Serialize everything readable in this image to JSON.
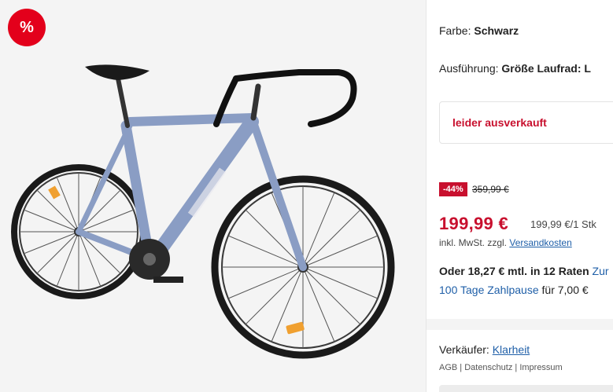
{
  "badge": {
    "symbol": "%"
  },
  "variant": {
    "color_label": "Farbe:",
    "color_value": "Schwarz",
    "model_label": "Ausführung:",
    "model_value": "Größe Laufrad: L"
  },
  "availability": {
    "status": "leider ausverkauft"
  },
  "pricing": {
    "discount": "-44%",
    "old_price": "359,99 €",
    "price": "199,99 €",
    "unit_price": "199,99 €/1 Stk",
    "tax_note": "inkl. MwSt. zzgl.",
    "shipping_link": "Versandkosten"
  },
  "financing": {
    "text": "Oder 18,27 € mtl. in 12 Raten",
    "more_link": "Zur",
    "pause_link": "100 Tage Zahlpause",
    "pause_suffix": "für 7,00 €"
  },
  "seller": {
    "label": "Verkäufer:",
    "name": "Klarheit",
    "legal": "AGB | Datenschutz | Impressum"
  },
  "colors": {
    "accent_red": "#c8102e",
    "badge_red": "#e3001b",
    "link_blue": "#1f5fa8",
    "frame_blue": "#8a9dc4"
  }
}
